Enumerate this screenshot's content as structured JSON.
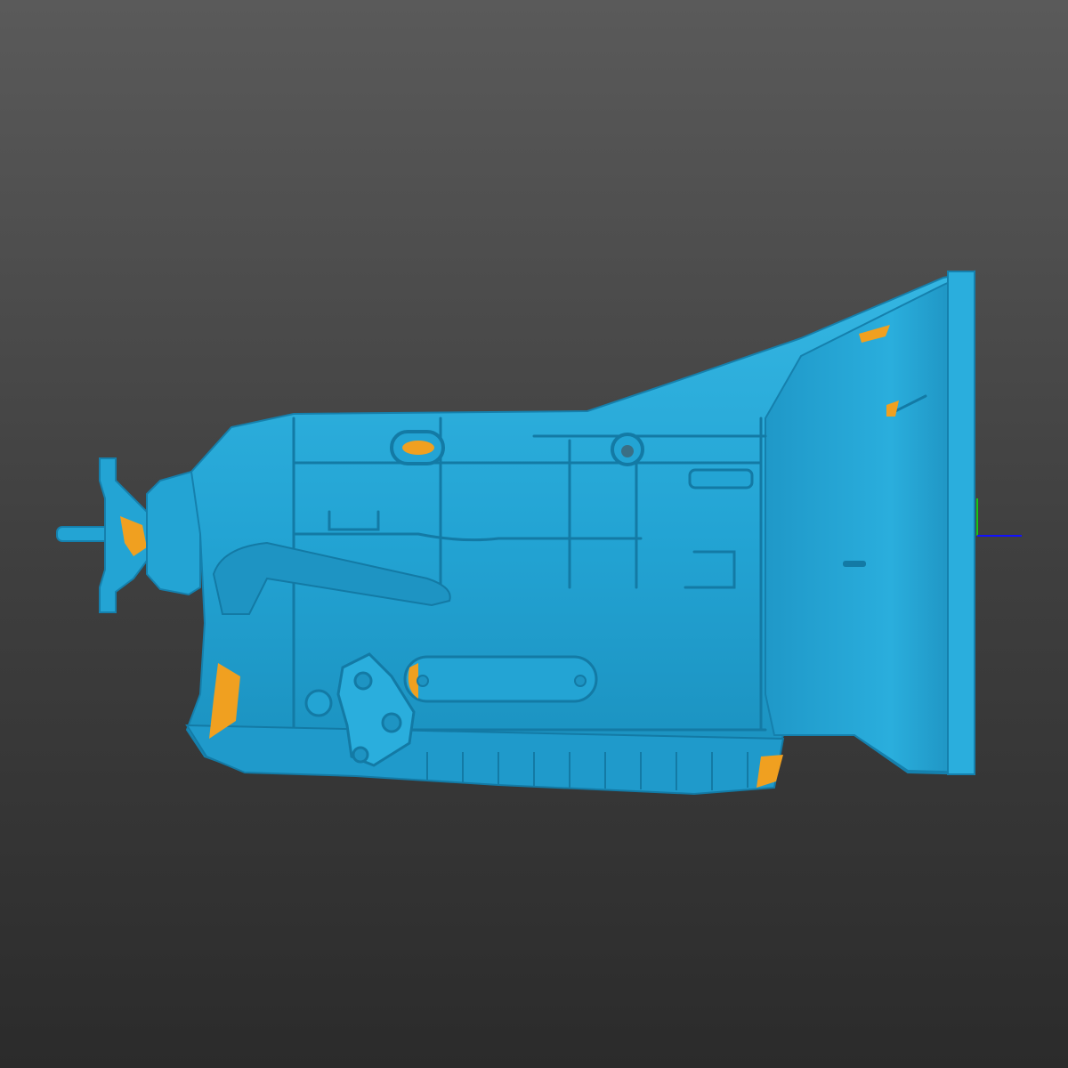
{
  "viewer": {
    "background_top": "#5a5a5a",
    "background_bottom": "#2b2b2b"
  },
  "model": {
    "surface_color": "#23a4d4",
    "surface_shade": "#1580ad",
    "surface_highlight": "#3fbde6",
    "backface_color": "#f0a020"
  },
  "axis_triad": {
    "z_color": "#1111ff",
    "y_color": "#18c418"
  }
}
